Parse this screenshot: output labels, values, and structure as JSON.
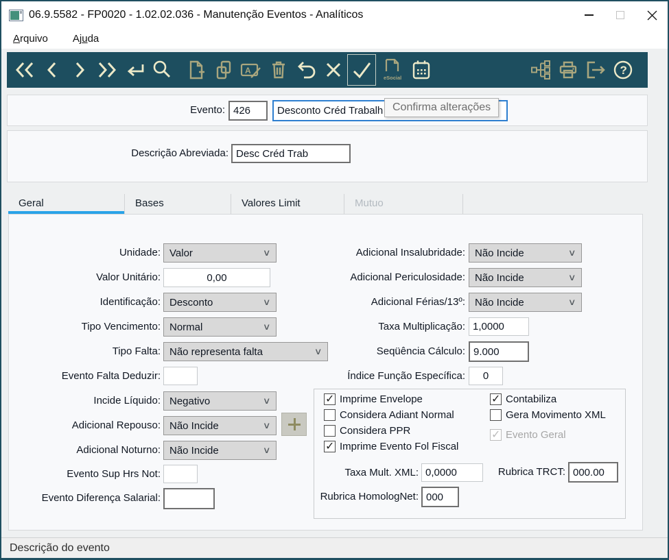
{
  "window": {
    "title": "06.9.5582 - FP0020 - 1.02.02.036 - Manutenção Eventos - Analíticos",
    "status": "Descrição do evento"
  },
  "menu": {
    "items": [
      {
        "pre": "",
        "accel": "A",
        "post": "rquivo"
      },
      {
        "pre": "Aj",
        "accel": "u",
        "post": "da"
      }
    ]
  },
  "toolbar": {
    "tooltip": "Confirma alterações",
    "esocial_label": "eSocial",
    "help_glyph": "?",
    "icons": [
      "first-record",
      "previous-record",
      "next-record",
      "last-record",
      "go",
      "search",
      "new-record",
      "copy-record",
      "edit-record",
      "delete-record",
      "undo",
      "cancel",
      "confirm",
      "esocial",
      "calendar",
      "program-tree",
      "print",
      "exit",
      "help"
    ]
  },
  "header": {
    "evento_label": "Evento:",
    "evento_value": "426",
    "evento_descricao": "Desconto Créd Trabalh",
    "abrev_label": "Descrição Abreviada:",
    "abrev_value": "Desc Créd Trab"
  },
  "tabs": [
    {
      "label": "Geral"
    },
    {
      "label": "Bases"
    },
    {
      "label": "Valores Limit"
    },
    {
      "label": "Mutuo"
    }
  ],
  "geral": {
    "unidade": {
      "label": "Unidade:",
      "value": "Valor"
    },
    "valor_unitario": {
      "label": "Valor Unitário:",
      "value": "0,00"
    },
    "identificacao": {
      "label": "Identificação:",
      "value": "Desconto"
    },
    "tipo_vencimento": {
      "label": "Tipo Vencimento:",
      "value": "Normal"
    },
    "tipo_falta": {
      "label": "Tipo Falta:",
      "value": "Não representa falta"
    },
    "evento_falta_deduzir": {
      "label": "Evento Falta Deduzir:",
      "value": ""
    },
    "incide_liquido": {
      "label": "Incide Líquido:",
      "value": "Negativo"
    },
    "adicional_repouso": {
      "label": "Adicional Repouso:",
      "value": "Não Incide"
    },
    "adicional_noturno": {
      "label": "Adicional Noturno:",
      "value": "Não Incide"
    },
    "evento_sup_hrs_not": {
      "label": "Evento Sup Hrs Not:",
      "value": ""
    },
    "evento_diferenca_salarial": {
      "label": "Evento Diferença Salarial:",
      "value": ""
    },
    "adicional_insalubridade": {
      "label": "Adicional Insalubridade:",
      "value": "Não Incide"
    },
    "adicional_periculosidade": {
      "label": "Adicional Periculosidade:",
      "value": "Não Incide"
    },
    "adicional_ferias_13": {
      "label": "Adicional Férias/13º:",
      "value": "Não Incide"
    },
    "taxa_multiplicacao": {
      "label": "Taxa Multiplicação:",
      "value": "1,0000"
    },
    "sequencia_calculo": {
      "label": "Seqüência Cálculo:",
      "value": "9.000"
    },
    "indice_funcao_especifica": {
      "label": "Índice Função Específica:",
      "value": "0"
    },
    "checks": {
      "imprime_envelope": {
        "label": "Imprime Envelope",
        "checked": true
      },
      "considera_adiant_normal": {
        "label": "Considera Adiant Normal",
        "checked": false
      },
      "considera_ppr": {
        "label": "Considera PPR",
        "checked": false
      },
      "imprime_evento_fol_fiscal": {
        "label": "Imprime Evento Fol Fiscal",
        "checked": true
      },
      "contabiliza": {
        "label": "Contabiliza",
        "checked": true
      },
      "gera_movimento_xml": {
        "label": "Gera Movimento XML",
        "checked": false
      },
      "evento_geral": {
        "label": "Evento Geral",
        "checked": true,
        "disabled": true
      }
    },
    "taxa_mult_xml": {
      "label": "Taxa Mult. XML:",
      "value": "0,0000"
    },
    "rubrica_trct": {
      "label": "Rubrica TRCT:",
      "value": "000.00"
    },
    "rubrica_homolognet": {
      "label": "Rubrica HomologNet:",
      "value": "000"
    }
  },
  "colors": {
    "toolbar_bg": "#1d4e5f",
    "icon_bright": "#ece9c8",
    "icon_dim": "#a9a67e",
    "tab_accent": "#29a3e8",
    "focus_border": "#2e7fd0"
  }
}
